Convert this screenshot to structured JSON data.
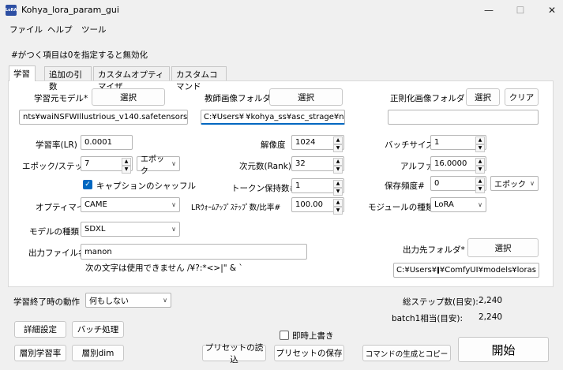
{
  "window": {
    "title": "Kohya_lora_param_gui",
    "icon_text": "LoRA",
    "min_glyph": "—",
    "max_glyph": "☐",
    "close_glyph": "✕"
  },
  "menu": [
    "ファイル",
    "ヘルプ",
    "ツール"
  ],
  "hint": "#がつく項目は0を指定すると無効化",
  "tabs": [
    "学習",
    "追加の引数",
    "カスタムオプティマイザ",
    "カスタムコマンド"
  ],
  "learn": {
    "source_model_label": "学習元モデル*",
    "select": "選択",
    "source_model_value": "nts¥waiNSFWIllustrious_v140.safetensors",
    "teacher_folder_label": "教師画像フォルダ*",
    "teacher_folder_prefix": "C:¥Users¥",
    "teacher_folder_suffix": "¥kohya_ss¥asc_strage¥n",
    "reg_folder_label": "正則化画像フォルダ",
    "clear": "クリア",
    "reg_folder_value": "",
    "lr_label": "学習率(LR)",
    "lr_value": "0.0001",
    "resolution_label": "解像度",
    "resolution_value": "1024",
    "batch_label": "バッチサイズ",
    "batch_value": "1",
    "epoch_label": "エポック/ステップ",
    "epoch_value": "7",
    "epoch_unit": "エポック",
    "rank_label": "次元数(Rank)",
    "rank_value": "32",
    "alpha_label": "アルファ",
    "alpha_value": "16.0000",
    "shuffle_label": "キャプションのシャッフル",
    "shuffle_checked": true,
    "token_label": "トークン保持数#",
    "token_value": "1",
    "save_freq_label": "保存頻度#",
    "save_freq_value": "0",
    "save_freq_unit": "エポック",
    "optimizer_label": "オプティマイザ",
    "optimizer_value": "CAME",
    "warmup_label": "LRｳｫｰﾑｱｯﾌﾟｽﾃｯﾌﾟ数/比率#",
    "warmup_value": "100.00",
    "module_label": "モジュールの種類",
    "module_value": "LoRA",
    "model_type_label": "モデルの種類",
    "model_type_value": "SDXL",
    "output_folder_label": "出力先フォルダ*",
    "output_folder_prefix": "C:¥Users¥",
    "output_folder_suffix": "¥ComfyUI¥models¥loras",
    "output_name_label": "出力ファイル名",
    "output_name_value": "manon",
    "invalid_chars_note": "次の文字は使用できません /¥?:*<>|\" & `"
  },
  "bottom": {
    "end_action_label": "学習終了時の動作",
    "end_action_value": "何もしない",
    "total_steps_label": "総ステップ数(目安):",
    "total_steps_value": "2,240",
    "per_batch_label": "batch1相当(目安):",
    "per_batch_value": "2,240",
    "detail_settings": "詳細設定",
    "batch_process": "バッチ処理",
    "layer_lr": "層別学習率",
    "layer_dim": "層別dim",
    "overwrite_label": "即時上書き",
    "overwrite_checked": false,
    "load_preset": "プリセットの読込",
    "save_preset": "プリセットの保存",
    "gen_copy_command": "コマンドの生成とコピー",
    "start": "開始"
  },
  "colors": {
    "accent": "#0067c0",
    "panel_bg": "#ffffff",
    "window_bg": "#f0f0f0"
  }
}
